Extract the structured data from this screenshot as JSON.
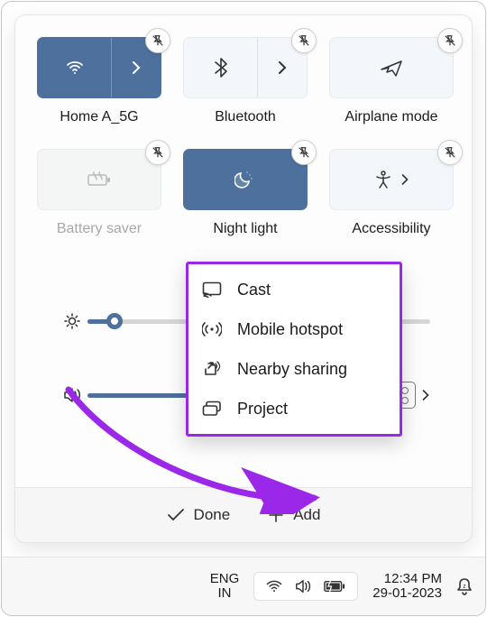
{
  "tiles": {
    "wifi": {
      "label": "Home A_5G"
    },
    "bluetooth": {
      "label": "Bluetooth"
    },
    "airplane": {
      "label": "Airplane mode"
    },
    "battery": {
      "label": "Battery saver"
    },
    "nightlight": {
      "label": "Night light"
    },
    "accessibility": {
      "label": "Accessibility"
    }
  },
  "sliders": {
    "brightness": {
      "value": 8
    },
    "volume": {
      "value": 78
    }
  },
  "menu": {
    "items": [
      {
        "label": "Cast"
      },
      {
        "label": "Mobile hotspot"
      },
      {
        "label": "Nearby sharing"
      },
      {
        "label": "Project"
      }
    ]
  },
  "footer": {
    "done": "Done",
    "add": "Add"
  },
  "taskbar": {
    "lang_top": "ENG",
    "lang_bot": "IN",
    "time": "12:34 PM",
    "date": "29-01-2023"
  },
  "colors": {
    "accent": "#4d709d",
    "highlight": "#9b28e8"
  }
}
